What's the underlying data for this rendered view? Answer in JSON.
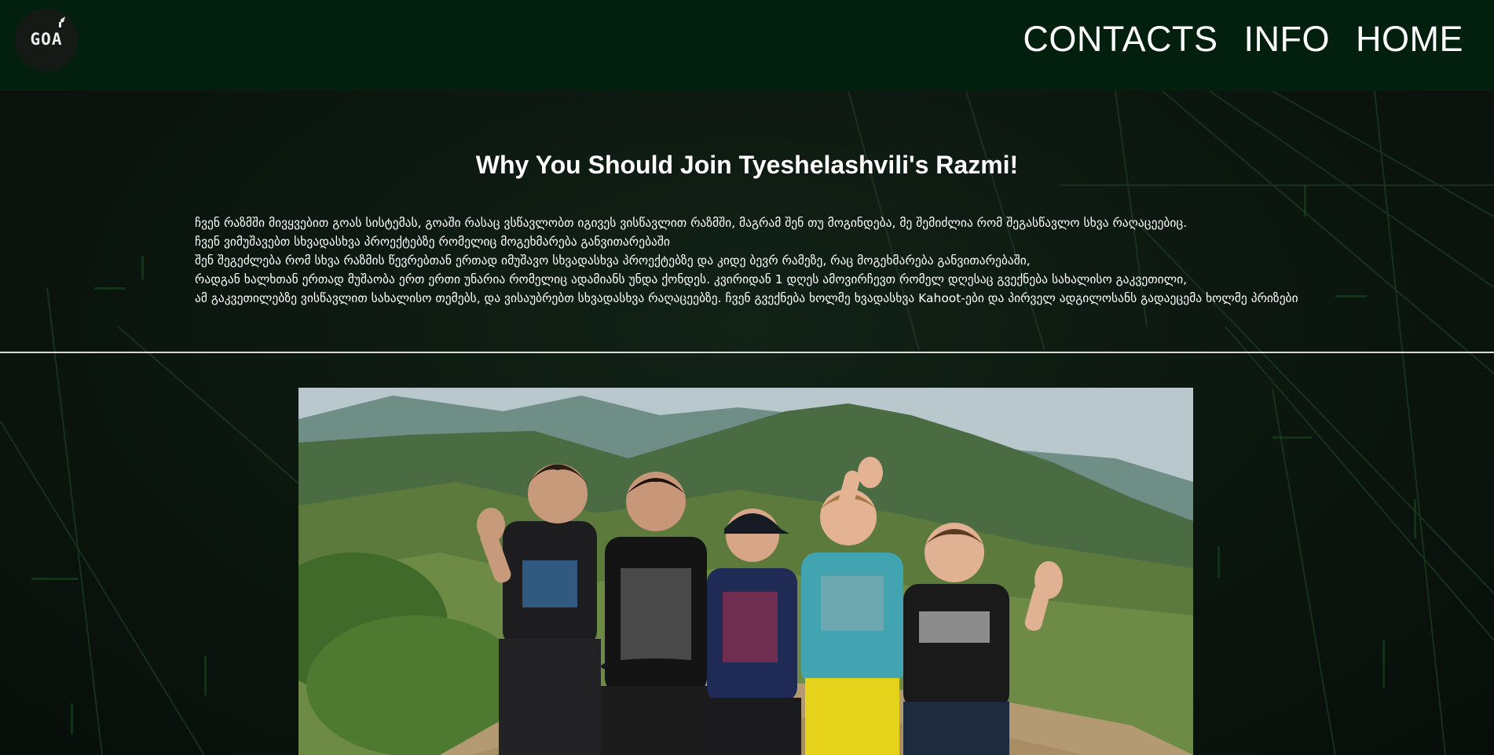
{
  "header": {
    "logo": {
      "text": "GOA",
      "icon": "goa-logo-icon"
    },
    "nav": [
      {
        "label": "CONTACTS"
      },
      {
        "label": "INFO"
      },
      {
        "label": "HOME"
      }
    ]
  },
  "intro": {
    "title": "Why You Should Join Tyeshelashvili's Razmi!",
    "lines": [
      "ჩვენ რაზმში მივყვებით გოას სისტემას, გოაში რასაც ვსწავლობთ იგივეს ვისწავლით რაზმში, მაგრამ შენ თუ მოგინდება, მე შემიძლია რომ შეგასწავლო სხვა რაღაცეებიც.",
      "ჩვენ ვიმუშავებთ სხვადასხვა პროექტებზე რომელიც მოგეხმარება განვითარებაში",
      "შენ შეგეძლება რომ სხვა რაზმის წევრებთან ერთად იმუშავო სხვადასხვა პროექტებზე და კიდე ბევრ რამეზე, რაც მოგეხმარება განვითარებაში,",
      "რადგან ხალხთან ერთად მუშაობა ერთ ერთი უნარია რომელიც ადამიანს უნდა ქონდეს. კვირიდან 1 დღეს ამოვირჩევთ რომელ დღესაც გვექნება სახალისო გაკვეთილი,",
      "ამ გაკვეთილებზე ვისწავლით სახალისო თემებს, და ვისაუბრებთ სხვადასხვა რაღაცეებზე. ჩვენ გვექნება ხოლმე ხვადასხვა Kahoot-ები და პირველ ადგილოსანს გადაეცემა ხოლმე პრიზები"
    ]
  },
  "photo": {
    "icon": "group-photo-image"
  },
  "colors": {
    "header_bg": "#03200f",
    "page_bg": "#0b140d",
    "text": "#ffffff",
    "divider": "#d9dcd9"
  }
}
